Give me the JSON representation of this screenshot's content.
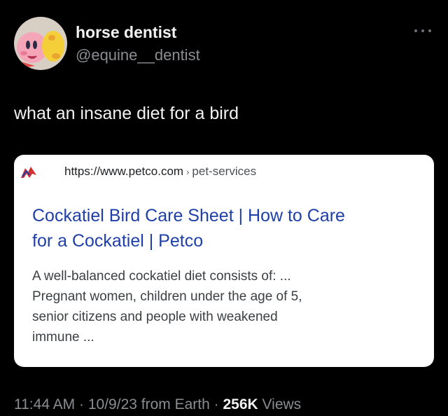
{
  "author": {
    "display_name": "horse dentist",
    "handle": "@equine__dentist",
    "avatar_icon": "kirby-avatar-icon"
  },
  "tweet": {
    "text": "what an insane diet for a bird"
  },
  "link_card": {
    "favicon": "petco-logo-icon",
    "url": "https://www.petco.com",
    "separator": "›",
    "path": "pet-services",
    "title": "Cockatiel Bird Care Sheet | How to Care for a Cockatiel | Petco",
    "title_line1": "Cockatiel Bird Care Sheet | How to Care",
    "title_line2": "for a Cockatiel | Petco",
    "snippet_lines": [
      "A well-balanced cockatiel diet consists of: ...",
      "Pregnant women, children under the age of 5,",
      "senior citizens and people with weakened",
      "immune ..."
    ]
  },
  "metadata": {
    "time": "11:44 AM",
    "date": "10/9/23",
    "source": "from Earth",
    "dot": "·",
    "views_count": "256K",
    "views_label": "Views"
  },
  "colors": {
    "background": "#000000",
    "card_background": "#ffffff",
    "link_title": "#1f3fa8",
    "muted_text": "#8a8d91"
  }
}
